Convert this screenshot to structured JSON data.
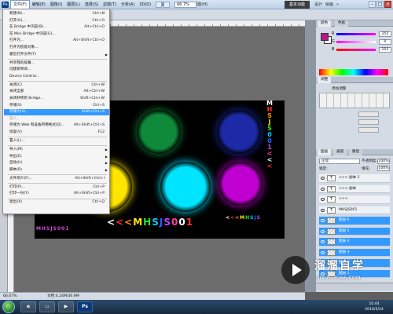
{
  "menubar": {
    "items": [
      "文件(F)",
      "编辑(E)",
      "图像(I)",
      "图层(L)",
      "选择(S)",
      "滤镜(T)",
      "分析(A)",
      "3D(D)",
      "视图(V)",
      "窗口(W)",
      "帮助(H)"
    ],
    "zoom": "66.7%",
    "workspace_button": "基本功能",
    "workspace_links": [
      "设计",
      "绘画",
      "»"
    ]
  },
  "file_menu": {
    "items": [
      {
        "label": "新建(N)...",
        "shortcut": "Ctrl+N"
      },
      {
        "label": "打开(O)...",
        "shortcut": "Ctrl+O"
      },
      {
        "label": "在 Bridge 中浏览(B)...",
        "shortcut": "Alt+Ctrl+O"
      },
      {
        "label": "在 Mini Bridge 中浏览(G)...",
        "shortcut": ""
      },
      {
        "label": "打开为...",
        "shortcut": "Alt+Shift+Ctrl+O"
      },
      {
        "label": "打开为智能对象...",
        "shortcut": ""
      },
      {
        "label": "最近打开文件(T)",
        "shortcut": "",
        "submenu": true
      },
      {
        "label": "共享我的屏幕...",
        "shortcut": ""
      },
      {
        "label": "创建新审阅...",
        "shortcut": ""
      },
      {
        "label": "Device Central...",
        "shortcut": ""
      },
      {
        "label": "关闭(C)",
        "shortcut": "Ctrl+W"
      },
      {
        "label": "关闭全部",
        "shortcut": "Alt+Ctrl+W"
      },
      {
        "label": "关闭并转到 Bridge...",
        "shortcut": "Shift+Ctrl+W"
      },
      {
        "label": "存储(S)",
        "shortcut": "Ctrl+S"
      },
      {
        "label": "存储为(A)...",
        "shortcut": "Shift+Ctrl+S",
        "highlighted": true
      },
      {
        "label": "签入...",
        "shortcut": "",
        "disabled": true
      },
      {
        "label": "存储为 Web 和设备所用格式(D)...",
        "shortcut": "Alt+Shift+Ctrl+S"
      },
      {
        "label": "恢复(V)",
        "shortcut": "F12"
      },
      {
        "label": "置入(L)...",
        "shortcut": ""
      },
      {
        "label": "导入(M)",
        "shortcut": "",
        "submenu": true
      },
      {
        "label": "导出(E)",
        "shortcut": "",
        "submenu": true
      },
      {
        "label": "自动(U)",
        "shortcut": "",
        "submenu": true
      },
      {
        "label": "脚本(R)",
        "shortcut": "",
        "submenu": true
      },
      {
        "label": "文件简介(F)...",
        "shortcut": "Alt+Shift+Ctrl+I"
      },
      {
        "label": "打印(P)...",
        "shortcut": "Ctrl+P"
      },
      {
        "label": "打印一份(Y)",
        "shortcut": "Alt+Shift+Ctrl+P"
      },
      {
        "label": "退出(X)",
        "shortcut": "Ctrl+Q"
      }
    ]
  },
  "canvas": {
    "text_main": "<<<MHSJS001",
    "text_small_left": "MHSJS001",
    "text_small_right": "<<<MHSJS",
    "text_vertical": "MHSJS001<<<",
    "circle_colors": [
      "#ff8a00",
      "#0e8a3a",
      "#1c2aa8",
      "#ffe600",
      "#00e5ff",
      "#c000d0"
    ]
  },
  "color_panel": {
    "channels": [
      {
        "name": "R",
        "value": "255"
      },
      {
        "name": "G",
        "value": "0"
      },
      {
        "name": "B",
        "value": "255"
      }
    ],
    "fg_color": "#b4188c",
    "bg_color": "#ffffff"
  },
  "adjust_panel": {
    "tab": "调整",
    "title": "添加调整"
  },
  "layers_panel": {
    "tabs": [
      "图层",
      "通道",
      "路径"
    ],
    "blend_mode": "正常",
    "opacity_label": "不透明度:",
    "opacity": "100%",
    "lock_label": "锁定:",
    "fill_label": "填充:",
    "fill": "100%",
    "layers": [
      {
        "name": "<<< 副本 2",
        "type": "text",
        "selected": false
      },
      {
        "name": "<<< 副本",
        "type": "text",
        "selected": false
      },
      {
        "name": "<<<",
        "type": "text",
        "selected": false
      },
      {
        "name": "MHSJS001",
        "type": "text",
        "selected": false
      },
      {
        "name": "图层 6",
        "type": "pixel",
        "selected": true
      },
      {
        "name": "图层 5",
        "type": "pixel",
        "selected": true
      },
      {
        "name": "图层 4",
        "type": "pixel",
        "selected": true
      },
      {
        "name": "图层 3",
        "type": "pixel",
        "selected": true
      },
      {
        "name": "图层 2",
        "type": "pixel",
        "selected": true
      },
      {
        "name": "图层 1",
        "type": "pixel",
        "selected": true
      }
    ]
  },
  "statusbar": {
    "zoom": "66.67%",
    "doc": "文档:4.24M/30.9M"
  },
  "watermark": {
    "title": "溜溜自学",
    "url": "ZIXUE.3D66.COM"
  },
  "taskbar": {
    "time": "10:44",
    "date": "2018/5/24"
  }
}
